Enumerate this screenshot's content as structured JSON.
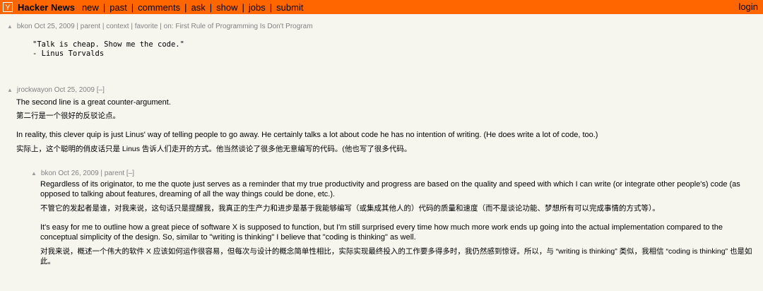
{
  "header": {
    "logo": "Y",
    "brand": "Hacker News",
    "nav": [
      "new",
      "past",
      "comments",
      "ask",
      "show",
      "jobs",
      "submit"
    ],
    "login": "login"
  },
  "comments": [
    {
      "author": "bk",
      "meta_rest": " on Oct 25, 2009 | parent | context | favorite | on: First Rule of Programming Is Don't Program",
      "code_lines": [
        "\"Talk is cheap. Show me the code.\"",
        "- Linus Torvalds"
      ]
    },
    {
      "author": "jrockway",
      "meta_rest": " on Oct 25, 2009 [–]",
      "paragraphs": [
        "The second line is a great counter-argument.",
        "第二行是一个很好的反驳论点。",
        "In reality, this clever quip is just Linus' way of telling people to go away. He certainly talks a lot about code he has no intention of writing. (He does write a lot of code, too.)",
        "实际上，这个聪明的俏皮话只是 Linus 告诉人们走开的方式。他当然谈论了很多他无意编写的代码。(他也写了很多代码。"
      ]
    },
    {
      "author": "bk",
      "meta_rest": " on Oct 26, 2009 | parent [–]",
      "paragraphs": [
        "Regardless of its originator, to me the quote just serves as a reminder that my true productivity and progress are based on the quality and speed with which I can write (or integrate other people's) code (as opposed to talking about features, dreaming of all the way things could be done, etc.).",
        "不管它的发起者是谁，对我来说，这句话只是提醒我，我真正的生产力和进步是基于我能够编写（或集成其他人的）代码的质量和速度（而不是谈论功能、梦想所有可以完成事情的方式等）。",
        "It's easy for me to outline how a great piece of software X is supposed to function, but I'm still surprised every time how much more work ends up going into the actual implementation compared to the conceptual simplicity of the design. So, similar to \"writing is thinking\" I believe that \"coding is thinking\" as well.",
        "对我来说，概述一个伟大的软件 X 应该如何运作很容易，但每次与设计的概念简单性相比，实际实现最终投入的工作要多得多时，我仍然感到惊讶。所以，与 “writing is thinking” 类似，我相信 “coding is thinking” 也是如此。"
      ]
    }
  ]
}
